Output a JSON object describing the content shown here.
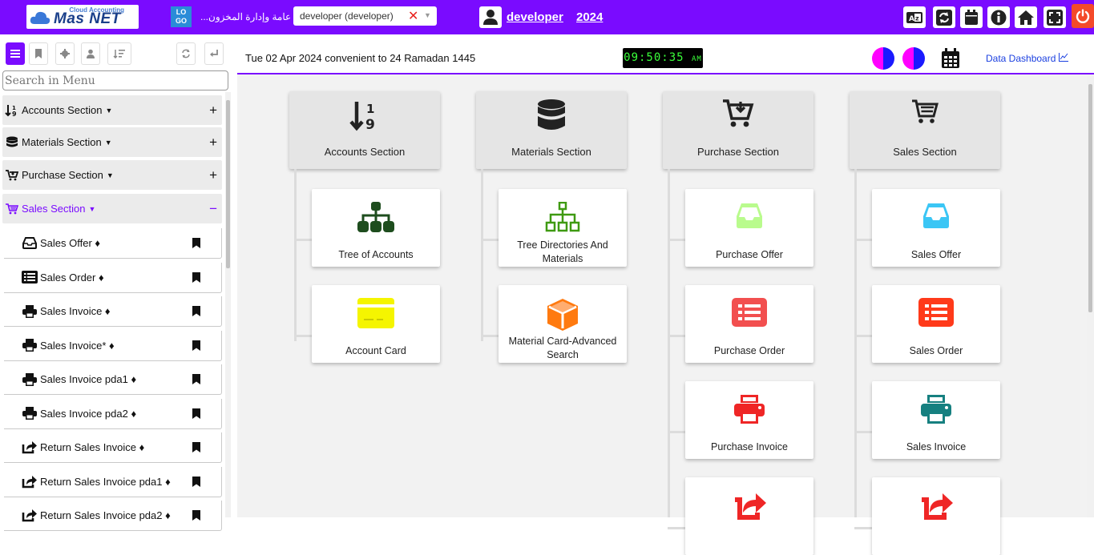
{
  "topbar": {
    "logo_top": "Cloud Accounting",
    "logo_main": "Mas NET",
    "logo_box": "LO GO",
    "company": "...عامة وإدارة المخزون",
    "user_select": "developer (developer)",
    "user_select_clear": "✕",
    "user_name": "developer",
    "year": "2024",
    "accent": "#7a0bff",
    "buttons": [
      "translate-icon",
      "refresh-icon",
      "calendar-icon",
      "info-icon",
      "home-icon",
      "fullscreen-icon",
      "power-icon"
    ]
  },
  "sidebar": {
    "search_placeholder": "Search in Menu",
    "sections": [
      {
        "label": "Accounts Section",
        "icon": "sort-numeric-icon",
        "toggle": "+"
      },
      {
        "label": "Materials Section",
        "icon": "database-icon",
        "toggle": "+"
      },
      {
        "label": "Purchase Section",
        "icon": "cart-down-icon",
        "toggle": "+"
      },
      {
        "label": "Sales Section",
        "icon": "cart-icon",
        "toggle": "−"
      }
    ],
    "items": [
      {
        "label": "Sales Offer ♦",
        "icon": "inbox-icon"
      },
      {
        "label": "Sales Order ♦",
        "icon": "list-icon"
      },
      {
        "label": "Sales Invoice ♦",
        "icon": "print-icon"
      },
      {
        "label": "Sales Invoice* ♦",
        "icon": "print-icon"
      },
      {
        "label": "Sales Invoice pda1 ♦",
        "icon": "print-icon"
      },
      {
        "label": "Sales Invoice pda2 ♦",
        "icon": "print-icon"
      },
      {
        "label": "Return Sales Invoice ♦",
        "icon": "share-icon"
      },
      {
        "label": "Return Sales Invoice pda1 ♦",
        "icon": "share-icon"
      },
      {
        "label": "Return Sales Invoice pda2 ♦",
        "icon": "share-icon"
      }
    ]
  },
  "header": {
    "date_text": "Tue 02 Apr 2024  convenient to  24 Ramadan 1445",
    "clock": "09:50:35",
    "clock_ampm": "AM",
    "dashboard_link": "Data Dashboard"
  },
  "columns": [
    {
      "title": "Accounts Section",
      "icon": "sort-numeric-icon",
      "cards": [
        {
          "label": "Tree of Accounts",
          "icon": "sitemap-icon",
          "color": "#1e4d1e"
        },
        {
          "label": "Account Card",
          "icon": "credit-card-icon",
          "color": "#f5f500"
        }
      ]
    },
    {
      "title": "Materials Section",
      "icon": "database-icon",
      "cards": [
        {
          "label": "Tree Directories And Materials",
          "icon": "sitemap-outline-icon",
          "color": "#3f9a12"
        },
        {
          "label": "Material Card-Advanced Search",
          "icon": "cube-icon",
          "color": "#ff7a0f"
        }
      ]
    },
    {
      "title": "Purchase Section",
      "icon": "cart-down-icon",
      "cards": [
        {
          "label": "Purchase Offer",
          "icon": "inbox-icon",
          "color": "#b9fb8d"
        },
        {
          "label": "Purchase Order",
          "icon": "list-icon",
          "color": "#f24f4f"
        },
        {
          "label": "Purchase Invoice",
          "icon": "print-icon",
          "color": "#ef2626"
        },
        {
          "label": "",
          "icon": "share-icon",
          "color": "#ef2626"
        }
      ]
    },
    {
      "title": "Sales Section",
      "icon": "cart-icon",
      "cards": [
        {
          "label": "Sales Offer",
          "icon": "inbox-icon",
          "color": "#3bc6f5"
        },
        {
          "label": "Sales Order",
          "icon": "list-icon",
          "color": "#ff3a1a"
        },
        {
          "label": "Sales Invoice",
          "icon": "print-icon",
          "color": "#168080"
        },
        {
          "label": "",
          "icon": "share-icon",
          "color": "#ef2626"
        }
      ]
    }
  ]
}
